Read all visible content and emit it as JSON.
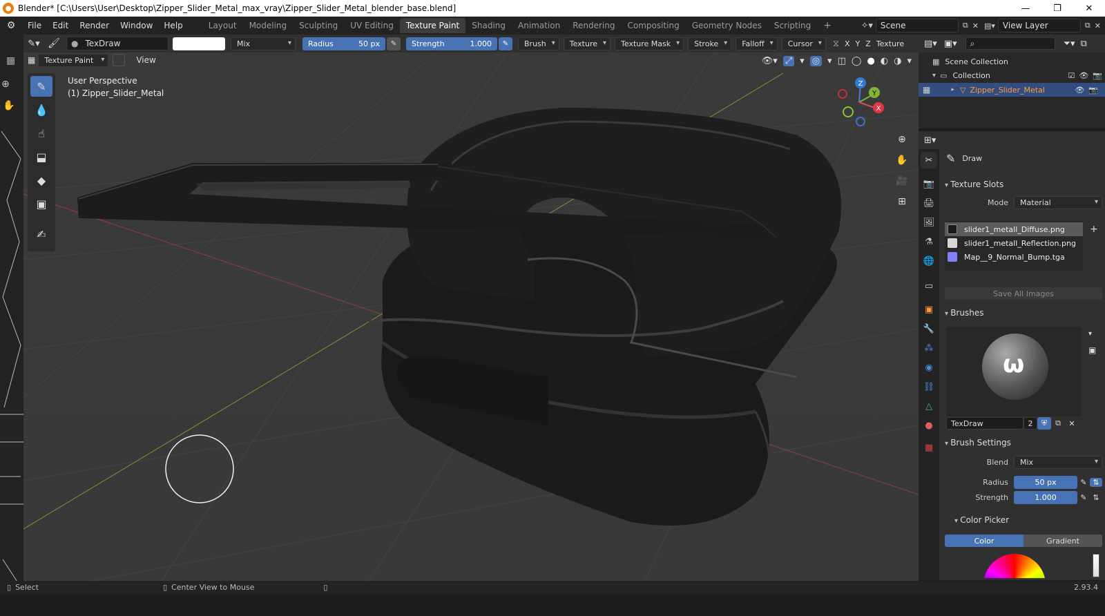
{
  "title": "Blender* [C:\\Users\\User\\Desktop\\Zipper_Slider_Metal_max_vray\\Zipper_Slider_Metal_blender_base.blend]",
  "menus": [
    "File",
    "Edit",
    "Render",
    "Window",
    "Help"
  ],
  "workspaces": [
    "Layout",
    "Modeling",
    "Sculpting",
    "UV Editing",
    "Texture Paint",
    "Shading",
    "Animation",
    "Rendering",
    "Compositing",
    "Geometry Nodes",
    "Scripting"
  ],
  "active_workspace": "Texture Paint",
  "scene": "Scene",
  "view_layer": "View Layer",
  "toolbar": {
    "brush_name": "TexDraw",
    "blend": "Mix",
    "radius_label": "Radius",
    "radius_value": "50 px",
    "strength_label": "Strength",
    "strength_value": "1.000",
    "menus": [
      "Brush",
      "Texture",
      "Texture Mask",
      "Stroke",
      "Falloff",
      "Cursor"
    ],
    "axes": [
      "X",
      "Y",
      "Z"
    ],
    "texture_label": "Texture"
  },
  "header2": {
    "mode": "Texture Paint",
    "view": "View"
  },
  "viewport": {
    "perspective": "User Perspective",
    "object": "(1) Zipper_Slider_Metal"
  },
  "gizmo": {
    "z": "Z",
    "y": "Y",
    "x": "X"
  },
  "outliner": {
    "scene_collection": "Scene Collection",
    "collection": "Collection",
    "object": "Zipper_Slider_Metal"
  },
  "properties": {
    "tool": "Draw",
    "texture_slots": "Texture Slots",
    "mode_label": "Mode",
    "mode_value": "Material",
    "slots": [
      {
        "name": "slider1_metall_Diffuse.png",
        "color": "#1a1a1a"
      },
      {
        "name": "slider1_metall_Reflection.png",
        "color": "#d8d8d8"
      },
      {
        "name": "Map__9_Normal_Bump.tga",
        "color": "#8080ff"
      }
    ],
    "save_all": "Save All Images",
    "brushes": "Brushes",
    "brush_name": "TexDraw",
    "brush_users": "2",
    "brush_settings": "Brush Settings",
    "blend_label": "Blend",
    "blend_value": "Mix",
    "radius_label": "Radius",
    "radius_value": "50 px",
    "strength_label": "Strength",
    "strength_value": "1.000",
    "color_picker": "Color Picker",
    "color_tab": "Color",
    "gradient_tab": "Gradient"
  },
  "status": {
    "select": "Select",
    "center": "Center View to Mouse",
    "version": "2.93.4"
  },
  "colors": {
    "accent": "#4772b3",
    "active_object": "#ff9b3d"
  }
}
